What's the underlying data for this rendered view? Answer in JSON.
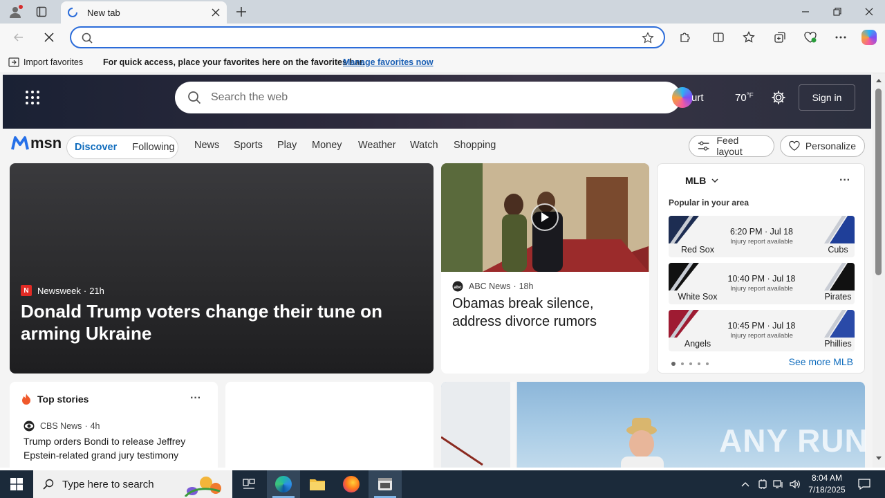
{
  "browser": {
    "tab_title": "New tab",
    "address_value": "",
    "favorites_bar": {
      "import_label": "Import favorites",
      "message": "For quick access, place your favorites here on the favorites bar.",
      "manage_link": "Manage favorites now"
    }
  },
  "msn": {
    "search_placeholder": "Search the web",
    "hero_partial_text": "urt",
    "temperature": "70",
    "temp_unit": "°F",
    "sign_in": "Sign in",
    "logo_text": "msn",
    "segment": {
      "discover": "Discover",
      "following": "Following"
    },
    "nav": [
      "News",
      "Sports",
      "Play",
      "Money",
      "Weather",
      "Watch",
      "Shopping"
    ],
    "feed_layout": "Feed layout",
    "personalize": "Personalize",
    "main_story": {
      "source": "Newsweek",
      "age": "21h",
      "source_badge": "N",
      "headline": "Donald Trump voters change their tune on arming Ukraine"
    },
    "second_story": {
      "source": "ABC News",
      "age": "18h",
      "headline": "Obamas break silence, address divorce rumors"
    },
    "mlb": {
      "league": "MLB",
      "popular": "Popular in your area",
      "games": [
        {
          "time": "6:20 PM · Jul 18",
          "note": "Injury report available",
          "home": "Red Sox",
          "away": "Cubs",
          "home_color": "#1d2d52",
          "away_color": "#1f3f99"
        },
        {
          "time": "10:40 PM · Jul 18",
          "note": "Injury report available",
          "home": "White Sox",
          "away": "Pirates",
          "home_color": "#111111",
          "away_color": "#111111"
        },
        {
          "time": "10:45 PM · Jul 18",
          "note": "Injury report available",
          "home": "Angels",
          "away": "Phillies",
          "home_color": "#9e1b32",
          "away_color": "#2a4aa8"
        }
      ],
      "see_more": "See more MLB"
    },
    "top_stories": {
      "title": "Top stories",
      "source": "CBS News",
      "age": "4h",
      "headline": "Trump orders Bondi to release Jeffrey Epstein-related grand jury testimony"
    }
  },
  "taskbar": {
    "search_placeholder": "Type here to search",
    "time": "8:04 AM",
    "date": "7/18/2025"
  },
  "watermark": "ANY RUN"
}
